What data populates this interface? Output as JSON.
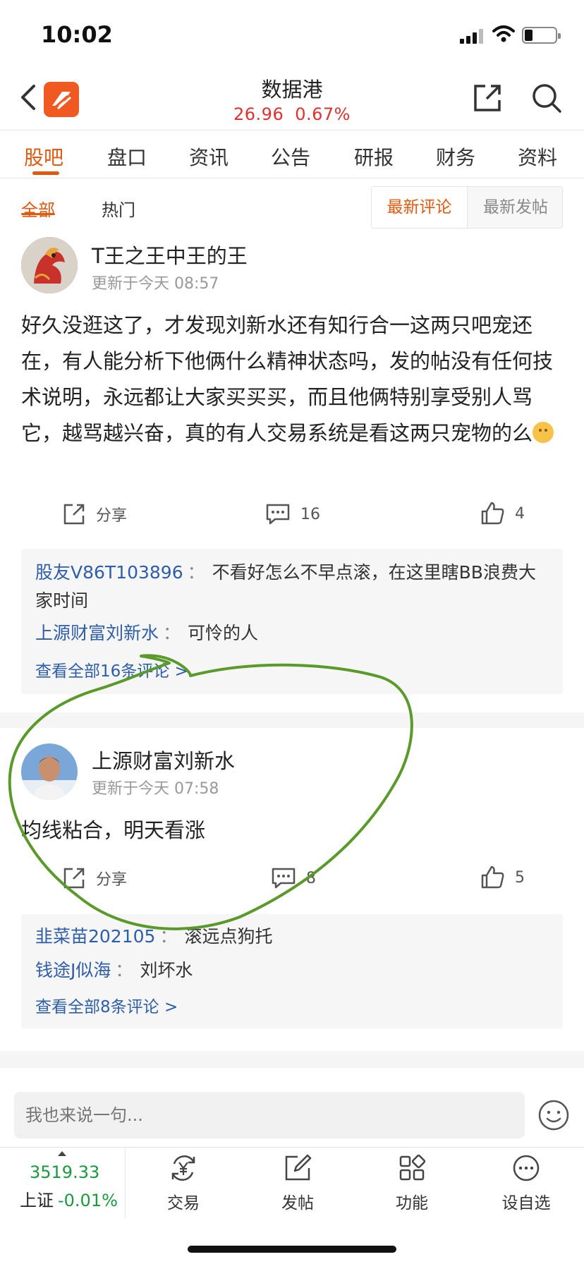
{
  "status_bar": {
    "time": "10:02"
  },
  "header": {
    "title": "数据港",
    "price": "26.96",
    "change_pct": "0.67%",
    "up_color": "#e03030",
    "brand_color": "#f05a22"
  },
  "tabs": [
    "股吧",
    "盘口",
    "资讯",
    "公告",
    "研报",
    "财务",
    "资料"
  ],
  "active_tab": "股吧",
  "filters": {
    "left": [
      "全部",
      "热门"
    ],
    "sort": [
      "最新评论",
      "最新发帖"
    ]
  },
  "posts": [
    {
      "author": "T王之王中王的王",
      "time": "更新于今天 08:57",
      "content": "好久没逛这了，才发现刘新水还有知行合一这两只吧宠还在，有人能分析下他俩什么精神状态吗，发的帖没有任何技术说明，永远都让大家买买买，而且他俩特别享受别人骂它，越骂越兴奋，真的有人交易系统是看这两只宠物的么",
      "share": "分享",
      "comments": "16",
      "likes": "4",
      "replies": [
        {
          "name": "股友V86T103896",
          "sep": "：",
          "text": "不看好怎么不早点滚，在这里瞎BB浪费大家时间"
        },
        {
          "name": "上源财富刘新水",
          "sep": "：",
          "text": "可怜的人"
        }
      ],
      "view_all": "查看全部16条评论 >"
    },
    {
      "author": "上源财富刘新水",
      "time": "更新于今天 07:58",
      "content": "均线粘合，明天看涨",
      "share": "分享",
      "comments": "8",
      "likes": "5",
      "replies": [
        {
          "name": "韭菜苗202105",
          "sep": "：",
          "text": "滚远点狗托"
        },
        {
          "name": "钱途J似海",
          "sep": "：",
          "text": "刘坏水"
        }
      ],
      "view_all": "查看全部8条评论 >"
    }
  ],
  "input": {
    "placeholder": "我也来说一句..."
  },
  "bottom_nav": {
    "index_value": "3519.33",
    "index_name": "上证",
    "index_change": "-0.01%",
    "items": [
      "交易",
      "发帖",
      "功能",
      "设自选"
    ]
  },
  "annotation_color": "#5a9a2a"
}
